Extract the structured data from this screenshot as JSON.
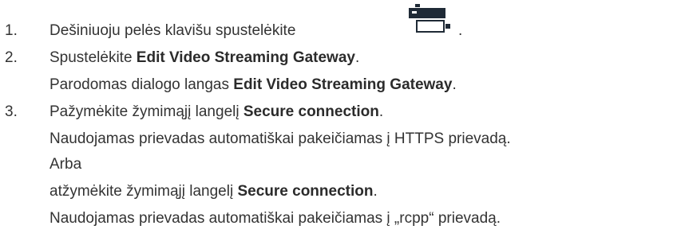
{
  "steps": [
    {
      "number": "1.",
      "parts": {
        "pre": "Dešiniuoju pelės klavišu spustelėkite",
        "post": "."
      }
    },
    {
      "number": "2.",
      "instruction": {
        "pre": "Spustelėkite ",
        "bold": "Edit Video Streaming Gateway",
        "post": "."
      },
      "result": {
        "pre": "Parodomas dialogo langas ",
        "bold": "Edit Video Streaming Gateway",
        "post": "."
      }
    },
    {
      "number": "3.",
      "instruction": {
        "pre": "Pažymėkite žymimąjį langelį ",
        "bold": "Secure connection",
        "post": "."
      },
      "result1": "Naudojamas prievadas automatiškai pakeičiamas į HTTPS prievadą.",
      "or": "Arba",
      "alt_instruction": {
        "pre": "atžymėkite žymimąjį langelį ",
        "bold": "Secure connection",
        "post": "."
      },
      "result2": "Naudojamas prievadas automatiškai pakeičiamas į „rcpp“ prievadą."
    }
  ],
  "icons": {
    "device": "video-streaming-gateway-icon"
  },
  "colors": {
    "text": "#333333",
    "icon": "#1f2a36"
  }
}
